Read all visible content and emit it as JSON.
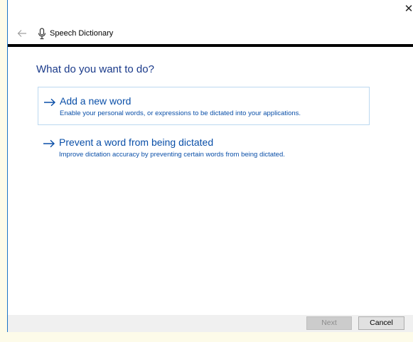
{
  "window": {
    "close_glyph": "✕"
  },
  "nav": {
    "back_icon": "left-arrow-icon",
    "app_icon": "microphone-icon",
    "title": "Speech Dictionary"
  },
  "main": {
    "heading": "What do you want to do?",
    "options": [
      {
        "title": "Add a new word",
        "description": "Enable your personal words, or expressions to be dictated into your applications.",
        "icon": "right-arrow-icon",
        "selected": true
      },
      {
        "title": "Prevent a word from being dictated",
        "description": "Improve dictation accuracy by preventing certain words from being dictated.",
        "icon": "right-arrow-icon",
        "selected": false
      }
    ]
  },
  "footer": {
    "next_label": "Next",
    "next_enabled": false,
    "cancel_label": "Cancel"
  },
  "colors": {
    "accent_text": "#0a4fa8",
    "heading_text": "#1a3a8a",
    "selection_border": "#bcd8f0",
    "footer_bg": "#f0f0f0",
    "window_edge": "#1a73c7"
  }
}
